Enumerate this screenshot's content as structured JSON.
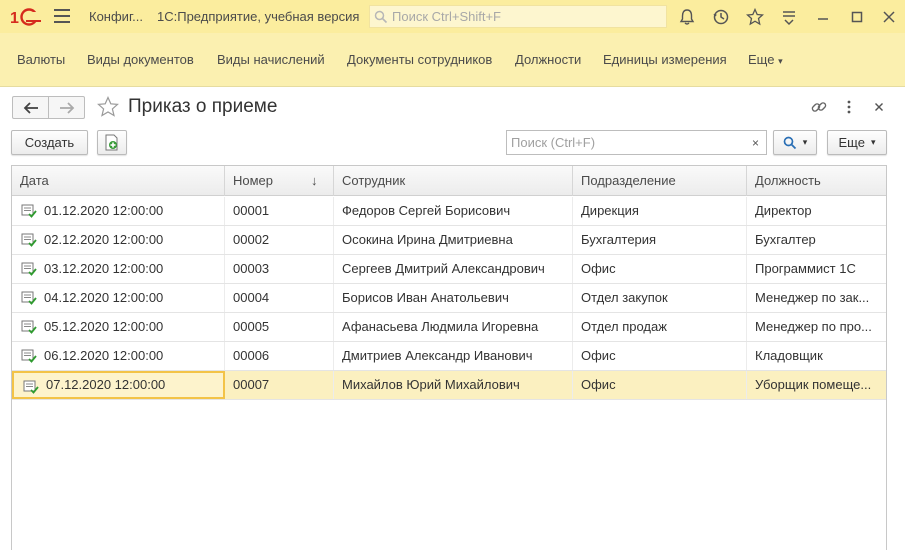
{
  "titlebar": {
    "config_label": "Конфиг...",
    "app_title": "1С:Предприятие, учебная версия",
    "search_placeholder": "Поиск Ctrl+Shift+F"
  },
  "sections": [
    "Валюты",
    "Виды документов",
    "Виды начислений",
    "Документы сотрудников",
    "Должности",
    "Единицы измерения",
    "Еще"
  ],
  "form": {
    "title": "Приказ о приеме",
    "create_label": "Создать",
    "search_placeholder": "Поиск (Ctrl+F)",
    "clear_label": "×",
    "more_label": "Еще"
  },
  "table": {
    "columns": [
      "Дата",
      "Номер",
      "Сотрудник",
      "Подразделение",
      "Должность"
    ],
    "sort_indicator": "↓",
    "rows": [
      {
        "date": "01.12.2020 12:00:00",
        "number": "00001",
        "employee": "Федоров Сергей Борисович",
        "department": "Дирекция",
        "position": "Директор"
      },
      {
        "date": "02.12.2020 12:00:00",
        "number": "00002",
        "employee": "Осокина Ирина Дмитриевна",
        "department": "Бухгалтерия",
        "position": "Бухгалтер"
      },
      {
        "date": "03.12.2020 12:00:00",
        "number": "00003",
        "employee": "Сергеев Дмитрий Александрович",
        "department": "Офис",
        "position": "Программист 1С"
      },
      {
        "date": "04.12.2020 12:00:00",
        "number": "00004",
        "employee": "Борисов Иван Анатольевич",
        "department": "Отдел закупок",
        "position": "Менеджер по зак..."
      },
      {
        "date": "05.12.2020 12:00:00",
        "number": "00005",
        "employee": "Афанасьева Людмила Игоревна",
        "department": "Отдел продаж",
        "position": "Менеджер по про..."
      },
      {
        "date": "06.12.2020 12:00:00",
        "number": "00006",
        "employee": "Дмитриев Александр Иванович",
        "department": "Офис",
        "position": "Кладовщик"
      },
      {
        "date": "07.12.2020 12:00:00",
        "number": "00007",
        "employee": "Михайлов Юрий Михайлович",
        "department": "Офис",
        "position": "Уборщик помеще..."
      }
    ],
    "current_row": 6
  },
  "colors": {
    "accent": "#fbed9e",
    "sections_bg": "#fbf0b0",
    "current_row": "#fbf0c0",
    "brand": "#d52b1e"
  }
}
